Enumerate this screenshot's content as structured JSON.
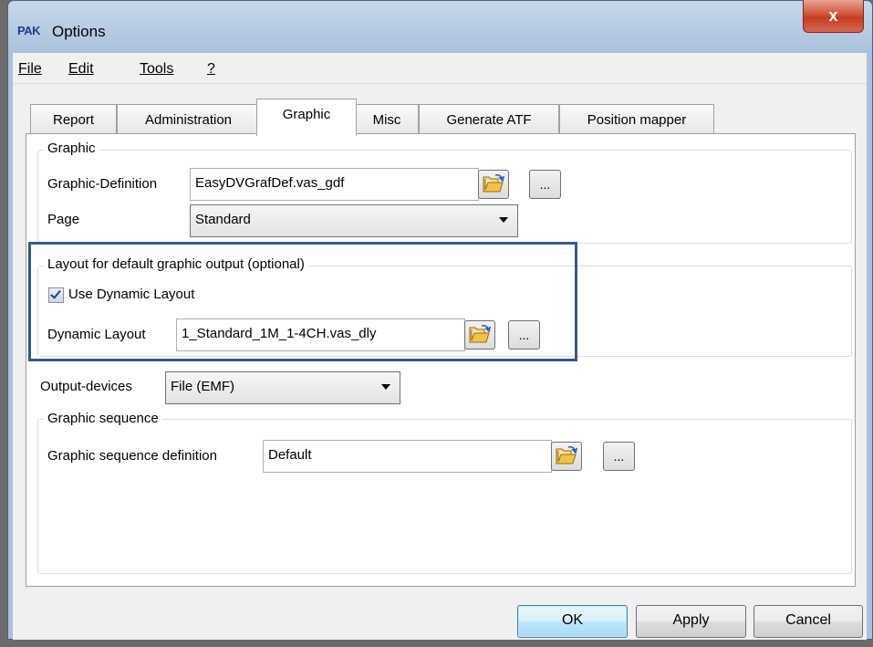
{
  "window": {
    "title": "Options",
    "app_logo": "PAK",
    "close_glyph": "x"
  },
  "menu": {
    "items": [
      "File",
      "Edit",
      "Tools",
      "?"
    ]
  },
  "tabs": [
    "Report",
    "Administration",
    "Graphic",
    "Misc",
    "Generate ATF",
    "Position mapper"
  ],
  "active_tab": "Graphic",
  "graphic_group": {
    "title": "Graphic",
    "definition_label": "Graphic-Definition",
    "definition_value": "EasyDVGrafDef.vas_gdf",
    "page_label": "Page",
    "page_value": "Standard"
  },
  "layout_group": {
    "title": "Layout for default graphic output (optional)",
    "use_dynamic_label": "Use Dynamic Layout",
    "use_dynamic_checked": true,
    "dynamic_layout_label": "Dynamic Layout",
    "dynamic_layout_value": "1_Standard_1M_1-4CH.vas_dly"
  },
  "output_devices": {
    "label": "Output-devices",
    "value": "File (EMF)"
  },
  "sequence_group": {
    "title": "Graphic sequence",
    "definition_label": "Graphic sequence definition",
    "definition_value": "Default"
  },
  "browse_button": {
    "label": "..."
  },
  "buttons": {
    "ok": "OK",
    "apply": "Apply",
    "cancel": "Cancel"
  },
  "colors": {
    "highlight_border": "#365b86",
    "close_button": "#c53a22",
    "title_bar": "#b3c8e0"
  }
}
